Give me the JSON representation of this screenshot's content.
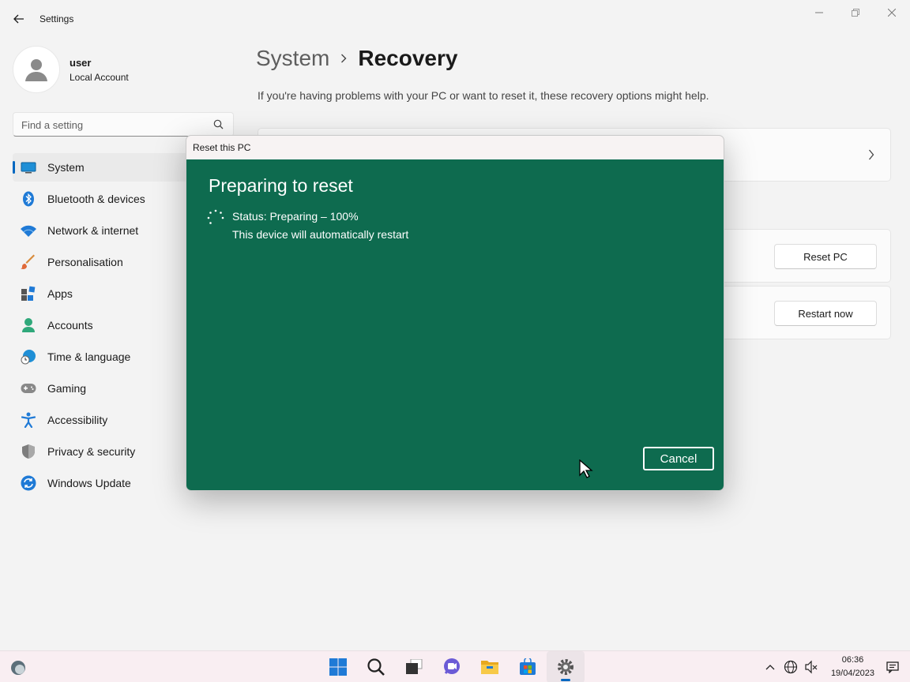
{
  "window": {
    "title": "Settings"
  },
  "profile": {
    "name": "user",
    "account_type": "Local Account"
  },
  "search": {
    "placeholder": "Find a setting"
  },
  "sidebar": {
    "items": [
      {
        "label": "System",
        "icon": "system-icon",
        "active": true
      },
      {
        "label": "Bluetooth & devices",
        "icon": "bluetooth-icon"
      },
      {
        "label": "Network & internet",
        "icon": "wifi-icon"
      },
      {
        "label": "Personalisation",
        "icon": "brush-icon"
      },
      {
        "label": "Apps",
        "icon": "apps-icon"
      },
      {
        "label": "Accounts",
        "icon": "account-icon"
      },
      {
        "label": "Time & language",
        "icon": "globe-clock-icon"
      },
      {
        "label": "Gaming",
        "icon": "gamepad-icon"
      },
      {
        "label": "Accessibility",
        "icon": "accessibility-icon"
      },
      {
        "label": "Privacy & security",
        "icon": "shield-icon"
      },
      {
        "label": "Windows Update",
        "icon": "update-icon"
      }
    ]
  },
  "main": {
    "breadcrumb_parent": "System",
    "breadcrumb_current": "Recovery",
    "subtitle": "If you're having problems with your PC or want to reset it, these recovery options might help.",
    "reset_button": "Reset PC",
    "restart_button": "Restart now"
  },
  "dialog": {
    "title": "Reset this PC",
    "heading": "Preparing to reset",
    "status": "Status: Preparing – 100%",
    "restart_note": "This device will automatically restart",
    "cancel_label": "Cancel",
    "background_color": "#0e6b4f"
  },
  "taskbar": {
    "time": "06:36",
    "date": "19/04/2023",
    "apps": [
      "start-icon",
      "search-icon",
      "task-view-icon",
      "chat-icon",
      "file-explorer-icon",
      "store-icon",
      "settings-icon"
    ]
  },
  "colors": {
    "accent": "#0067c0"
  }
}
